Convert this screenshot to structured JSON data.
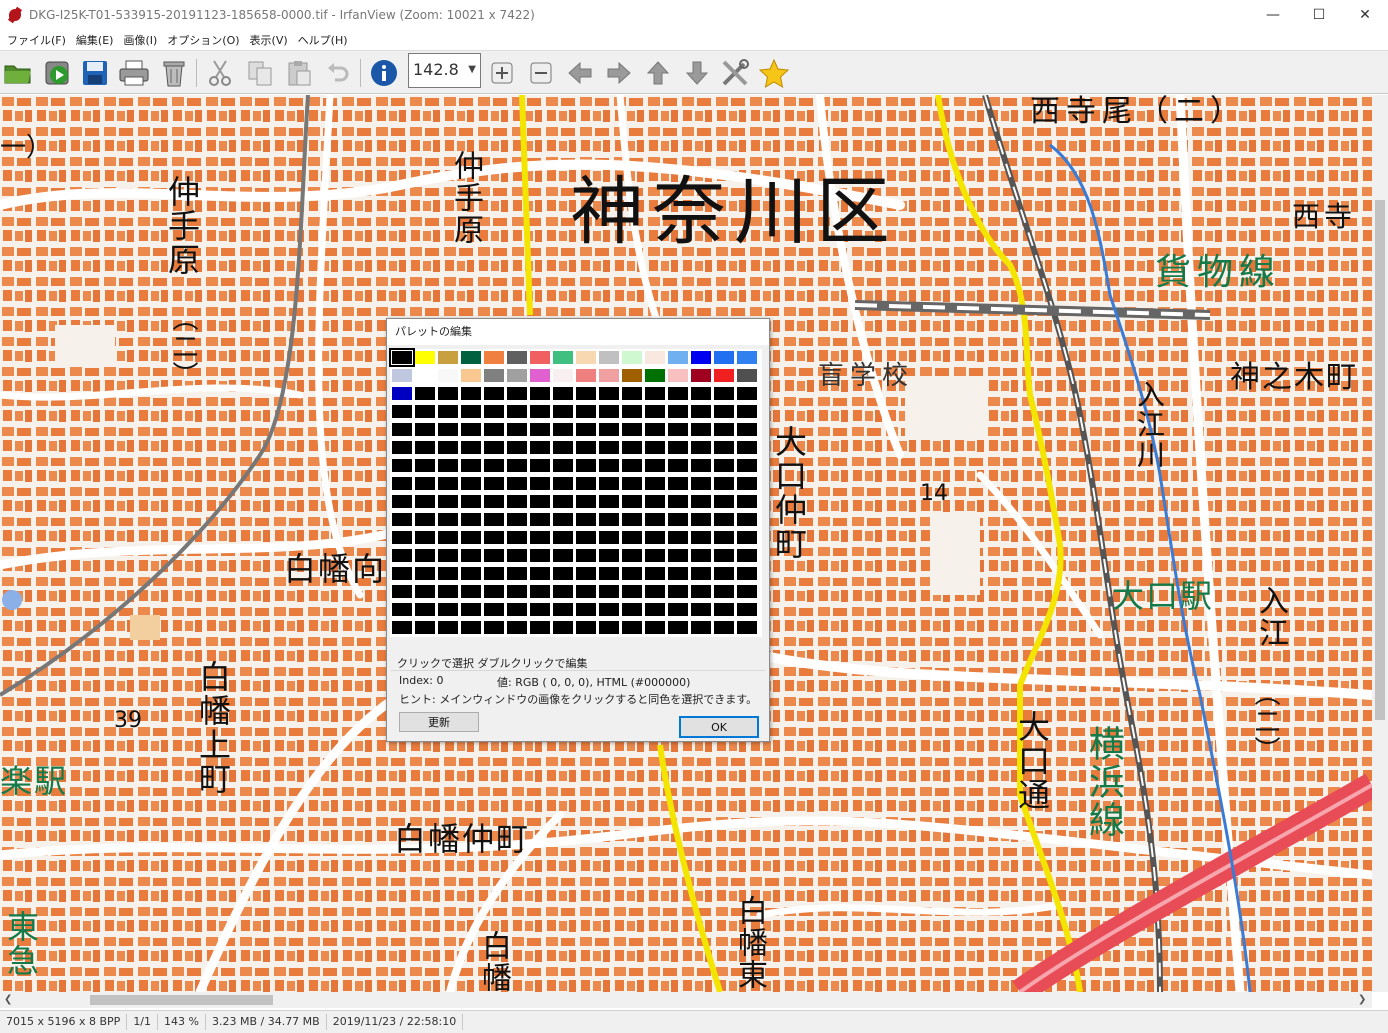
{
  "window": {
    "title": "DKG-I25K-T01-533915-20191123-185658-0000.tif - IrfanView (Zoom: 10021 x 7422)",
    "minimize": "—",
    "maximize": "☐",
    "close": "✕"
  },
  "menu": [
    "ファイル(F)",
    "編集(E)",
    "画像(I)",
    "オプション(O)",
    "表示(V)",
    "ヘルプ(H)"
  ],
  "toolbar": {
    "zoom_value": "142.8",
    "icons": [
      "open-folder-icon",
      "slideshow-icon",
      "save-icon",
      "print-icon",
      "trash-icon",
      "cut-icon",
      "copy-icon",
      "paste-icon",
      "undo-icon",
      "info-icon",
      "zoom-in-icon",
      "zoom-out-icon",
      "prev-icon",
      "next-icon",
      "up-icon",
      "down-icon",
      "tools-icon",
      "favorite-icon"
    ]
  },
  "map": {
    "labels": {
      "ward": "神奈川区",
      "nishiderao2": "西寺尾（二）",
      "nishidera": "西寺",
      "kamotsusen": "貨物線",
      "nakatebara": "仲手原",
      "nakatebara2": "仲手原",
      "nakatebara_num": "（二）",
      "mougakkou": "盲学校",
      "kaminokicho": "神之木町",
      "irie_river": "入江川",
      "ooguchi_nakamachi": "大口仲町",
      "elev14": "14",
      "hakuba_mukai": "白幡向",
      "ooguchi_eki": "大口駅",
      "irie": "入江",
      "irie_num": "（二）",
      "hakuba_kamicho": "白幡上町",
      "elev39": "39",
      "ooguchi_dori": "大口通",
      "yokohama_sen": "横浜線",
      "gakuraku_eki": "楽駅",
      "hakuba_nakamachi": "白幡仲町",
      "hakuba_higashi": "白幡東",
      "hakuba_bottom": "白幡",
      "toukyu": "東急",
      "left_top": "一）"
    }
  },
  "status": [
    "7015 x 5196 x 8 BPP",
    "1/1",
    "143 %",
    "3.23 MB / 34.77 MB",
    "2019/11/23 / 22:58:10"
  ],
  "dialog": {
    "title": "パレットの編集",
    "hint_click": "クリックで選択 ダブルクリックで編集",
    "index_label": "Index: 0",
    "value_label": "値: RGB (  0,  0,  0), HTML (#000000)",
    "tip": "ヒント: メインウィンドウの画像をクリックすると同色を選択できます。",
    "update_button": "更新",
    "ok_button": "OK",
    "palette_row1": [
      "#000000",
      "#ffff00",
      "#c8a040",
      "#006040",
      "#f08040",
      "#606060",
      "#f06060",
      "#40c080",
      "#f8d8b0",
      "#c0c0c0",
      "#d0f8d0",
      "#f8e8e0",
      "#70b0f0",
      "#0000f0",
      "#2070f0",
      "#3080f0"
    ],
    "palette_row2": [
      "#c0c8e0",
      "#ffffff",
      "#f8f8f8",
      "#f8c890",
      "#808080",
      "#a0a0a0",
      "#e060d0",
      "#f8f0f0",
      "#f08080",
      "#f0a0a0",
      "#a06000",
      "#007000",
      "#f8c0c0",
      "#a00020",
      "#f02020",
      "#505050"
    ],
    "palette_row3_first": "#0000c0",
    "palette_fill": "#000000"
  }
}
